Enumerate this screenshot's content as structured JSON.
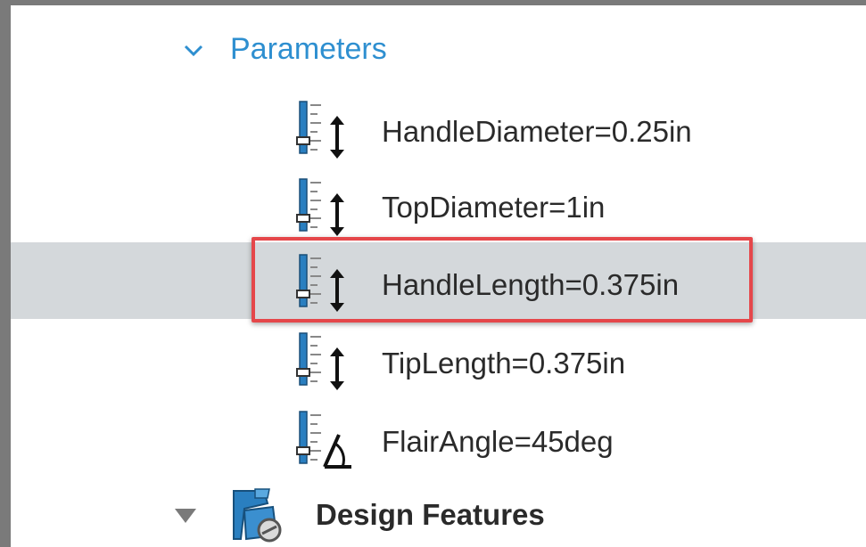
{
  "tree": {
    "parameters_section": {
      "title": "Parameters",
      "expanded": true,
      "items": [
        {
          "label": "HandleDiameter=0.25in",
          "icon": "length-parameter-icon"
        },
        {
          "label": "TopDiameter=1in",
          "icon": "length-parameter-icon"
        },
        {
          "label": "HandleLength=0.375in",
          "icon": "length-parameter-icon",
          "selected": true
        },
        {
          "label": "TipLength=0.375in",
          "icon": "length-parameter-icon"
        },
        {
          "label": "FlairAngle=45deg",
          "icon": "angle-parameter-icon"
        }
      ]
    },
    "design_features": {
      "title": "Design Features",
      "icon": "design-features-icon",
      "expanded": false
    }
  },
  "colors": {
    "section_title": "#2e8fd0",
    "selected_row": "#d4d8db",
    "highlight_border": "#e5474a",
    "icon_blue": "#2a7fc0"
  }
}
